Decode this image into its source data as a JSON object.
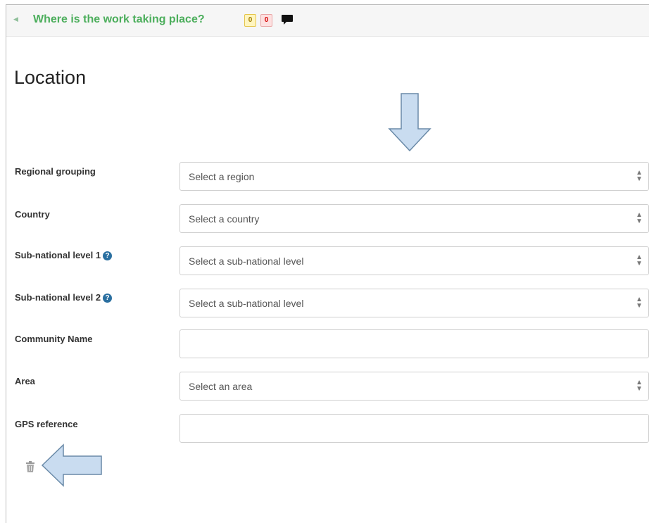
{
  "section": {
    "title": "Where is the work taking place?",
    "count_warning": "0",
    "count_error": "0"
  },
  "page": {
    "title": "Location"
  },
  "fields": {
    "region": {
      "label": "Regional grouping",
      "placeholder": "Select a region"
    },
    "country": {
      "label": "Country",
      "placeholder": "Select a country"
    },
    "subnational1": {
      "label": "Sub-national level 1",
      "placeholder": "Select a sub-national level"
    },
    "subnational2": {
      "label": "Sub-national level 2",
      "placeholder": "Select a sub-national level"
    },
    "community": {
      "label": "Community Name",
      "value": ""
    },
    "area": {
      "label": "Area",
      "placeholder": "Select an area"
    },
    "gps": {
      "label": "GPS reference",
      "value": ""
    }
  },
  "icons": {
    "caret": "caret-left-icon",
    "comment": "comment-icon",
    "help": "question-circle-icon",
    "trash": "trash-icon",
    "annotation_down": "down-arrow-icon",
    "annotation_left": "left-arrow-icon"
  },
  "colors": {
    "section_title": "#4cae5c",
    "help_icon": "#2a6fa0",
    "annotation_arrow_fill": "#c9dcf0",
    "annotation_arrow_stroke": "#6a8aa8"
  }
}
